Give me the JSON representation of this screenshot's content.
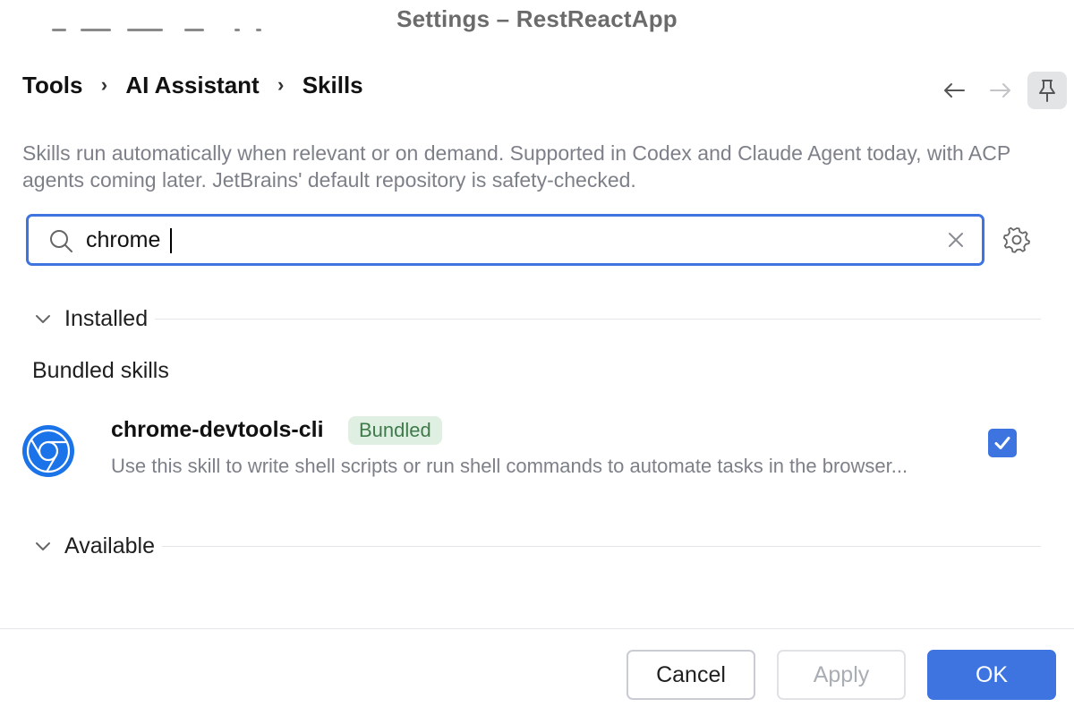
{
  "window": {
    "title": "Settings – RestReactApp"
  },
  "breadcrumb": {
    "items": [
      "Tools",
      "AI Assistant",
      "Skills"
    ],
    "separator": "›"
  },
  "navigation": {
    "back_icon": "arrow-left-icon",
    "forward_icon": "arrow-right-icon",
    "pin_icon": "pin-icon"
  },
  "description": "Skills run automatically when relevant or on demand. Supported in Codex and Claude Agent today, with ACP agents coming later. JetBrains' default repository is safety-checked.",
  "search": {
    "value": "chrome",
    "icon": "search-icon",
    "clear_icon": "close-icon",
    "settings_icon": "gear-icon"
  },
  "sections": {
    "installed": {
      "label": "Installed",
      "groups": [
        {
          "title": "Bundled skills",
          "skills": [
            {
              "name": "chrome-devtools-cli",
              "badge": "Bundled",
              "description": "Use this skill to write shell scripts or run shell commands to automate tasks in the browser...",
              "icon": "chrome-logo-icon",
              "enabled": true
            }
          ]
        }
      ]
    },
    "available": {
      "label": "Available"
    }
  },
  "footer": {
    "cancel_label": "Cancel",
    "apply_label": "Apply",
    "ok_label": "OK"
  },
  "colors": {
    "accent": "#3d74e0",
    "badge_bg": "#dff0e2",
    "badge_text": "#3f7a4a",
    "muted_text": "#7d8088"
  }
}
